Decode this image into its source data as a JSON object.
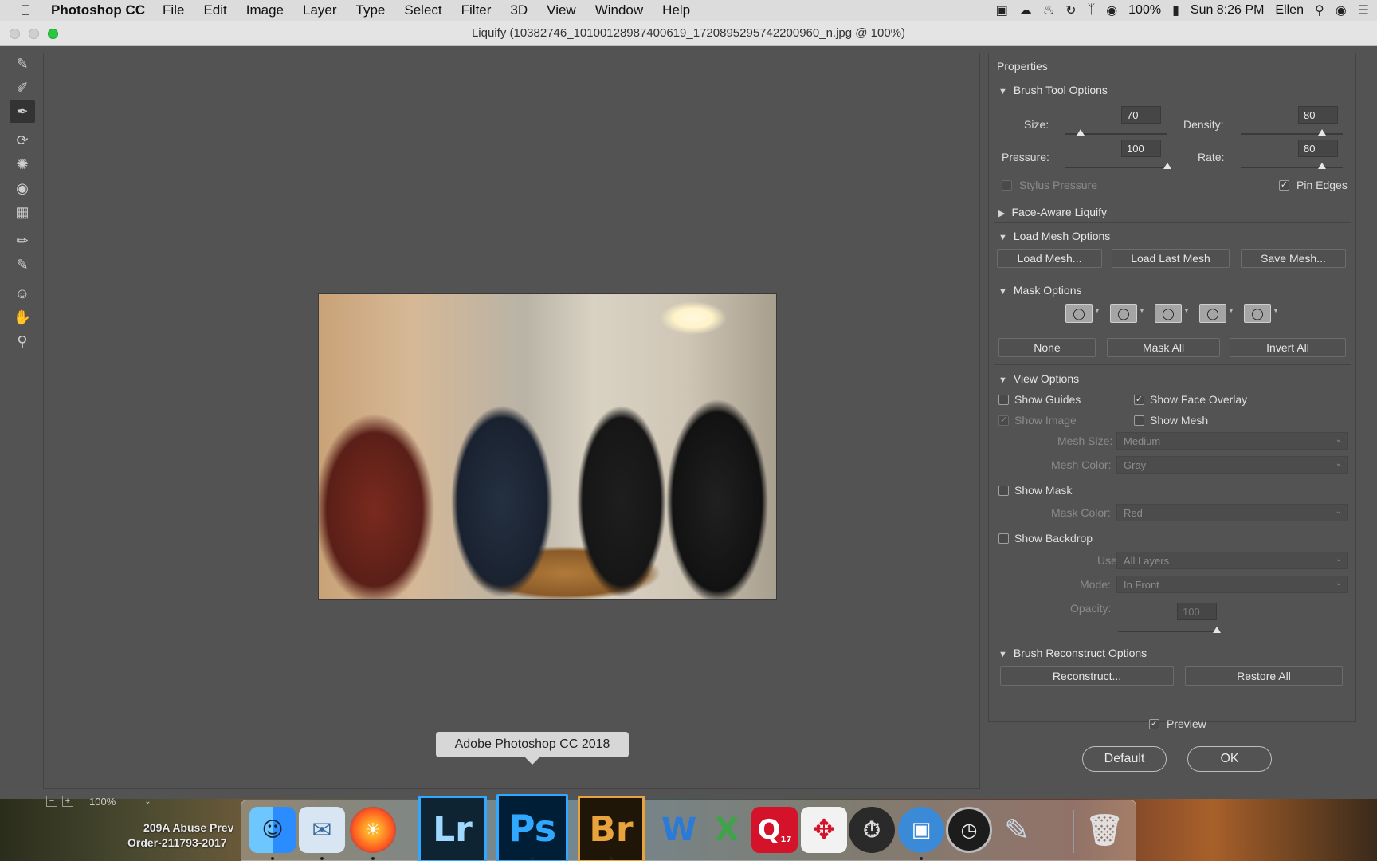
{
  "menubar": {
    "app_name": "Photoshop CC",
    "items": [
      "File",
      "Edit",
      "Image",
      "Layer",
      "Type",
      "Select",
      "Filter",
      "3D",
      "View",
      "Window",
      "Help"
    ],
    "battery": "100%",
    "clock": "Sun 8:26 PM",
    "user": "Ellen"
  },
  "window": {
    "title": "Liquify (10382746_10100128987400619_1720895295742200960_n.jpg @ 100%)"
  },
  "tools": [
    "forward-warp-tool",
    "reconstruct-tool",
    "smooth-tool",
    "twirl-tool",
    "pucker-tool",
    "bloat-tool",
    "push-left-tool",
    "freeze-mask-tool",
    "thaw-mask-tool",
    "face-tool",
    "hand-tool",
    "zoom-tool"
  ],
  "canvas": {
    "zoom_value": "100%",
    "image_alt": "Four women laughing around a kitchen table with a large wooden bowl of salad"
  },
  "properties": {
    "title": "Properties",
    "brush_tool_options": {
      "header": "Brush Tool Options",
      "size_label": "Size:",
      "size_value": "70",
      "size_level": 0.15,
      "density_label": "Density:",
      "density_value": "80",
      "density_level": 0.8,
      "pressure_label": "Pressure:",
      "pressure_value": "100",
      "pressure_level": 1.0,
      "rate_label": "Rate:",
      "rate_value": "80",
      "rate_level": 0.8,
      "stylus_pressure_label": "Stylus Pressure",
      "stylus_pressure_checked": false,
      "pin_edges_label": "Pin Edges",
      "pin_edges_checked": true
    },
    "face_aware": {
      "header": "Face-Aware Liquify"
    },
    "load_mesh_options": {
      "header": "Load Mesh Options",
      "load_mesh": "Load Mesh...",
      "load_last_mesh": "Load Last Mesh",
      "save_mesh": "Save Mesh..."
    },
    "mask_options": {
      "header": "Mask Options",
      "none": "None",
      "mask_all": "Mask All",
      "invert_all": "Invert All"
    },
    "view_options": {
      "header": "View Options",
      "show_guides": "Show Guides",
      "show_face_overlay": "Show Face Overlay",
      "show_image": "Show Image",
      "show_mesh": "Show Mesh",
      "mesh_size_label": "Mesh Size:",
      "mesh_size_value": "Medium",
      "mesh_color_label": "Mesh Color:",
      "mesh_color_value": "Gray",
      "show_mask": "Show Mask",
      "mask_color_label": "Mask Color:",
      "mask_color_value": "Red",
      "show_backdrop": "Show Backdrop",
      "use_label": "Use:",
      "use_value": "All Layers",
      "mode_label": "Mode:",
      "mode_value": "In Front",
      "opacity_label": "Opacity:",
      "opacity_value": "100",
      "opacity_level": 1.0
    },
    "brush_reconstruct": {
      "header": "Brush Reconstruct Options",
      "reconstruct": "Reconstruct...",
      "restore_all": "Restore All"
    }
  },
  "footer": {
    "preview_label": "Preview",
    "preview_checked": true,
    "default_button": "Default",
    "ok_button": "OK"
  },
  "tooltip": "Adobe Photoshop CC 2018",
  "desktop": {
    "file1": "209A Abuse Prev",
    "file2": "Order-211793-2017"
  },
  "dock": {
    "lightroom": "Lr",
    "photoshop": "Ps",
    "bridge": "Br",
    "quicken_badge": "17"
  },
  "colors": {
    "panel_bg": "#535353",
    "lightroom_accent": "#31a8ff",
    "photoshop_accent": "#31a8ff",
    "bridge_accent": "#e8a33c",
    "zoom_green": "#2ac83f"
  }
}
